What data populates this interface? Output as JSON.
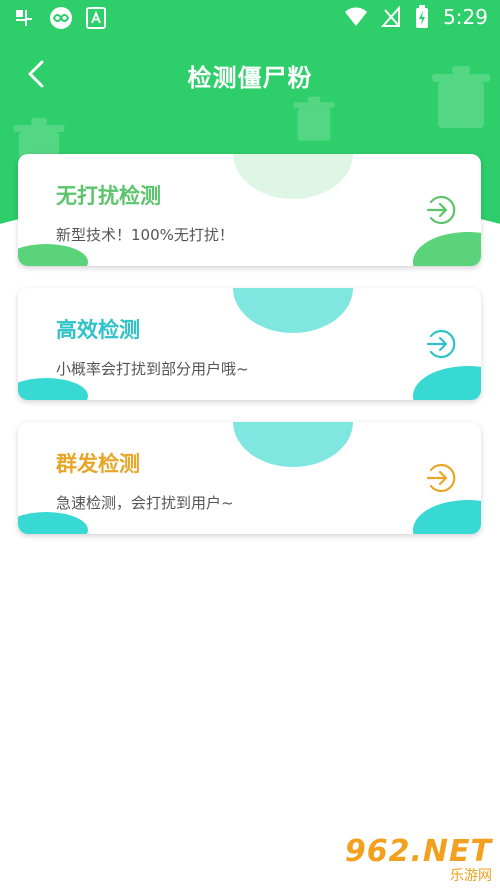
{
  "statusbar": {
    "time": "5:29"
  },
  "header": {
    "title": "检测僵尸粉"
  },
  "cards": [
    {
      "title": "无打扰检测",
      "subtitle": "新型技术！100%无打扰！",
      "title_color": "#5cc46b",
      "accent": "#5ad37a"
    },
    {
      "title": "高效检测",
      "subtitle": "小概率会打扰到部分用户哦~",
      "title_color": "#2fc2c9",
      "accent": "#38d9d2"
    },
    {
      "title": "群发检测",
      "subtitle": "急速检测，会打扰到用户~",
      "title_color": "#e8a628",
      "accent": "#38d9d2"
    }
  ],
  "watermark": {
    "text": "962.NET",
    "sub": "乐游网"
  }
}
